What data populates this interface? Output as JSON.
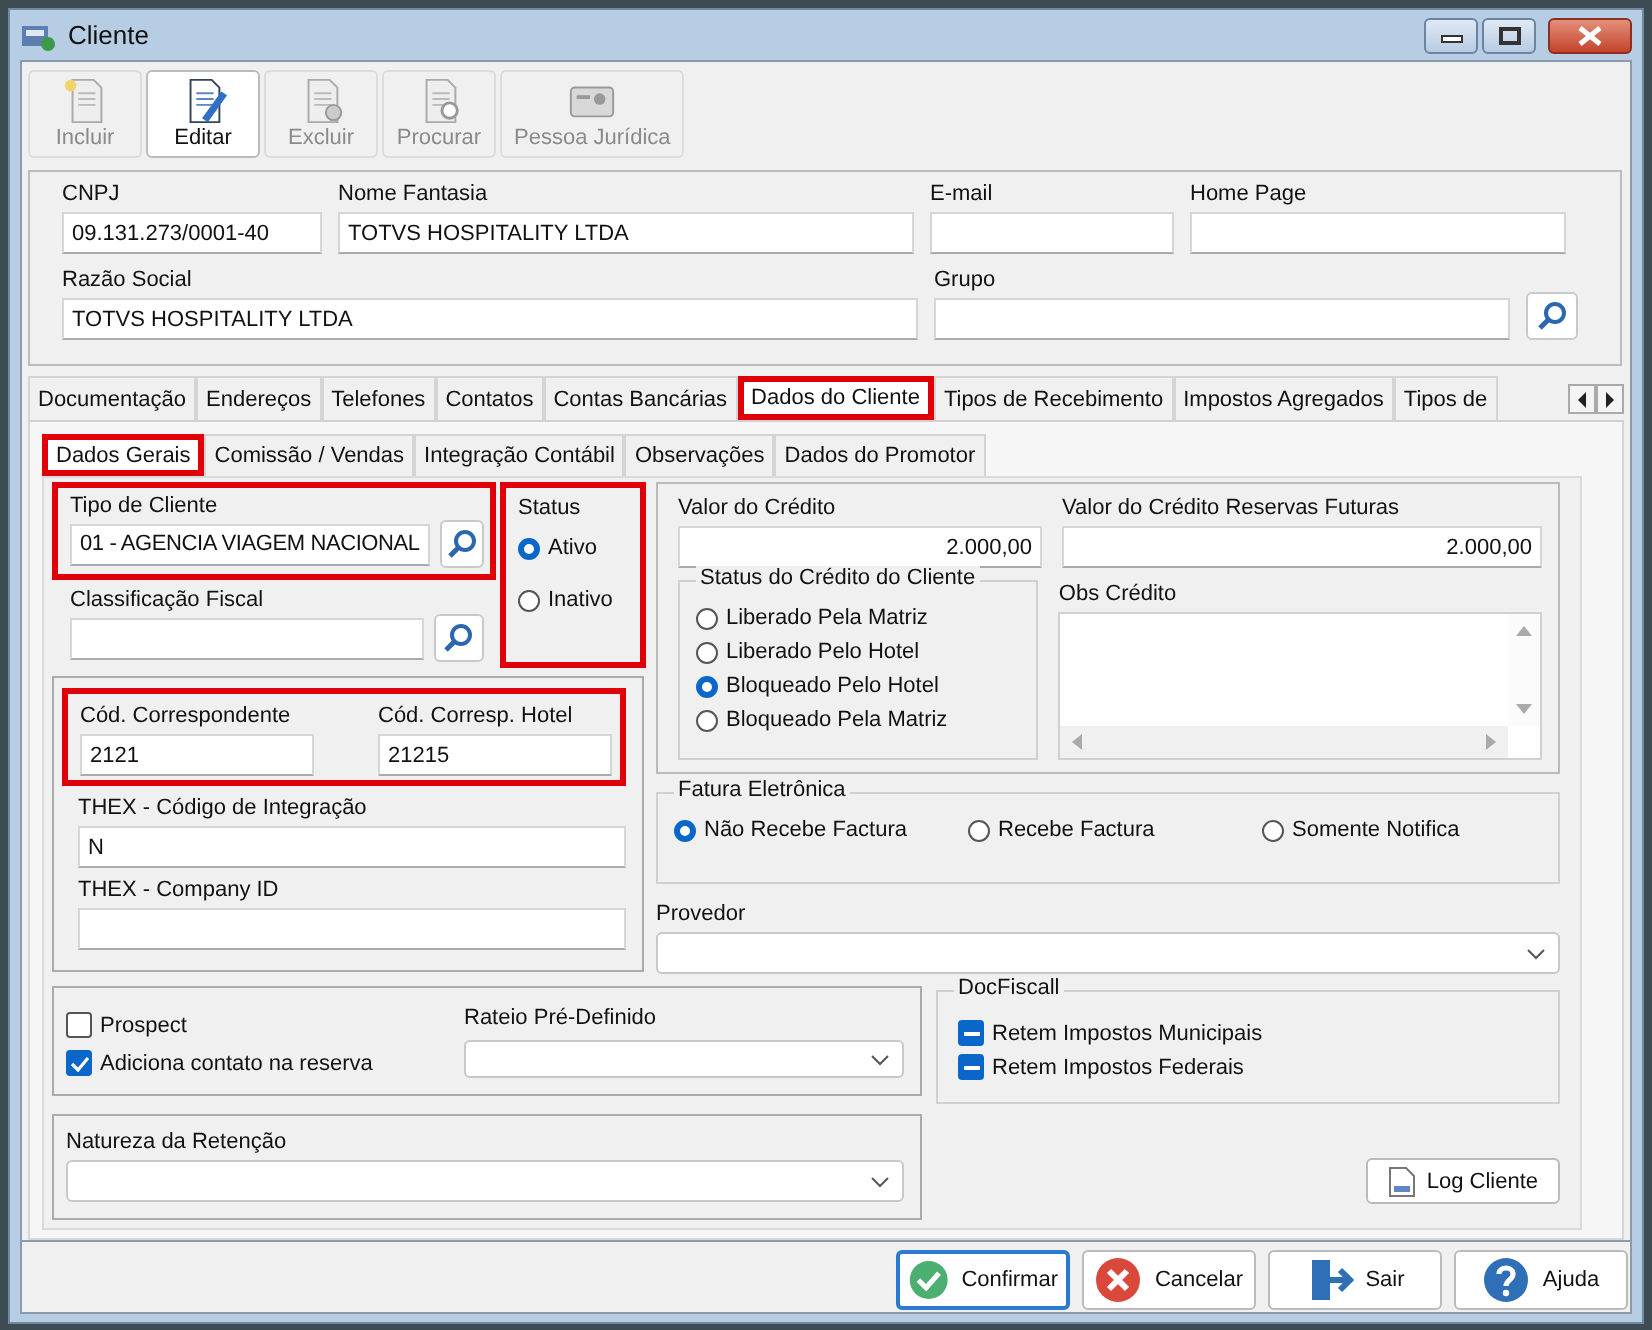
{
  "window": {
    "title": "Cliente"
  },
  "toolbar": [
    {
      "label": "Incluir",
      "kind": "new",
      "disabled": true
    },
    {
      "label": "Editar",
      "kind": "edit",
      "disabled": false
    },
    {
      "label": "Excluir",
      "kind": "delete",
      "disabled": true
    },
    {
      "label": "Procurar",
      "kind": "search",
      "disabled": true
    },
    {
      "label": "Pessoa Jurídica",
      "kind": "card",
      "disabled": true
    }
  ],
  "header": {
    "row1": [
      {
        "label": "CNPJ",
        "value": "09.131.273/0001-40"
      },
      {
        "label": "Nome Fantasia",
        "value": "TOTVS HOSPITALITY LTDA"
      },
      {
        "label": "E-mail"
      },
      {
        "label": "Home Page"
      }
    ],
    "row2": [
      {
        "label": "Razão Social",
        "value": "TOTVS HOSPITALITY LTDA"
      },
      {
        "label": "Grupo"
      }
    ]
  },
  "tabs": [
    {
      "label": "Documentação",
      "selected": false,
      "highlighted": false
    },
    {
      "label": "Endereços",
      "selected": false,
      "highlighted": false
    },
    {
      "label": "Telefones",
      "selected": false,
      "highlighted": false
    },
    {
      "label": "Contatos",
      "selected": false,
      "highlighted": false
    },
    {
      "label": "Contas Bancárias",
      "selected": false,
      "highlighted": false
    },
    {
      "label": "Dados do Cliente",
      "selected": true,
      "highlighted": true
    },
    {
      "label": "Tipos de Recebimento",
      "selected": false,
      "highlighted": false
    },
    {
      "label": "Impostos Agregados",
      "selected": false,
      "highlighted": false
    },
    {
      "label": "Tipos de",
      "selected": false,
      "highlighted": false
    }
  ],
  "subtabs": [
    {
      "label": "Dados Gerais",
      "selected": true,
      "highlighted": true
    },
    {
      "label": "Comissão / Vendas",
      "selected": false,
      "highlighted": false
    },
    {
      "label": "Integração Contábil",
      "selected": false,
      "highlighted": false
    },
    {
      "label": "Observações",
      "selected": false,
      "highlighted": false
    },
    {
      "label": "Dados do Promotor",
      "selected": false,
      "highlighted": false
    }
  ],
  "tipo_cliente": {
    "label": "Tipo de Cliente",
    "value": "01 - AGENCIA VIAGEM NACIONAL",
    "highlighted": true
  },
  "classificacao_fiscal": {
    "label": "Classificação Fiscal",
    "highlighted": false
  },
  "status": {
    "legend": "Status",
    "highlighted": true,
    "options": [
      {
        "label": "Ativo",
        "selected": true
      },
      {
        "label": "Inativo",
        "selected": false
      }
    ]
  },
  "codes": {
    "highlighted": true,
    "fields": [
      {
        "label": "Cód. Correspondente",
        "value": "2121"
      },
      {
        "label": "Cód. Corresp. Hotel",
        "value": "21215"
      }
    ]
  },
  "thex": [
    {
      "label": "THEX - Código de Integração",
      "value": "N"
    },
    {
      "label": "THEX - Company ID"
    }
  ],
  "credit": {
    "value_label": "Valor do Crédito",
    "value": "2.000,00",
    "future_label": "Valor do Crédito Reservas Futuras",
    "future_value": "2.000,00",
    "status_legend": "Status do Crédito do Cliente",
    "status_options": [
      {
        "label": "Liberado Pela Matriz",
        "selected": false
      },
      {
        "label": "Liberado Pelo Hotel",
        "selected": false
      },
      {
        "label": "Bloqueado Pelo Hotel",
        "selected": true
      },
      {
        "label": "Bloqueado Pela Matriz",
        "selected": false
      }
    ],
    "obs_label": "Obs Crédito"
  },
  "fatura": {
    "legend": "Fatura Eletrônica",
    "options": [
      {
        "label": "Não Recebe Factura",
        "selected": true
      },
      {
        "label": "Recebe Factura",
        "selected": false
      },
      {
        "label": "Somente Notifica",
        "selected": false
      }
    ]
  },
  "provedor": {
    "label": "Provedor"
  },
  "flags": [
    {
      "label": "Prospect",
      "checked": false
    },
    {
      "label": "Adiciona contato na reserva",
      "checked": true
    }
  ],
  "rateio": {
    "label": "Rateio Pré-Definido"
  },
  "natureza": {
    "label": "Natureza da Retenção"
  },
  "docfiscal": {
    "legend": "DocFiscall",
    "items": [
      {
        "label": "Retem Impostos Municipais",
        "indeterminate": true
      },
      {
        "label": "Retem Impostos Federais",
        "indeterminate": true
      }
    ]
  },
  "log_button": "Log Cliente",
  "footer": [
    {
      "label": "Confirmar",
      "kind": "confirm",
      "focused": true
    },
    {
      "label": "Cancelar",
      "kind": "cancel",
      "focused": false
    },
    {
      "label": "Sair",
      "kind": "exit",
      "focused": false
    },
    {
      "label": "Ajuda",
      "kind": "help",
      "focused": false
    }
  ]
}
